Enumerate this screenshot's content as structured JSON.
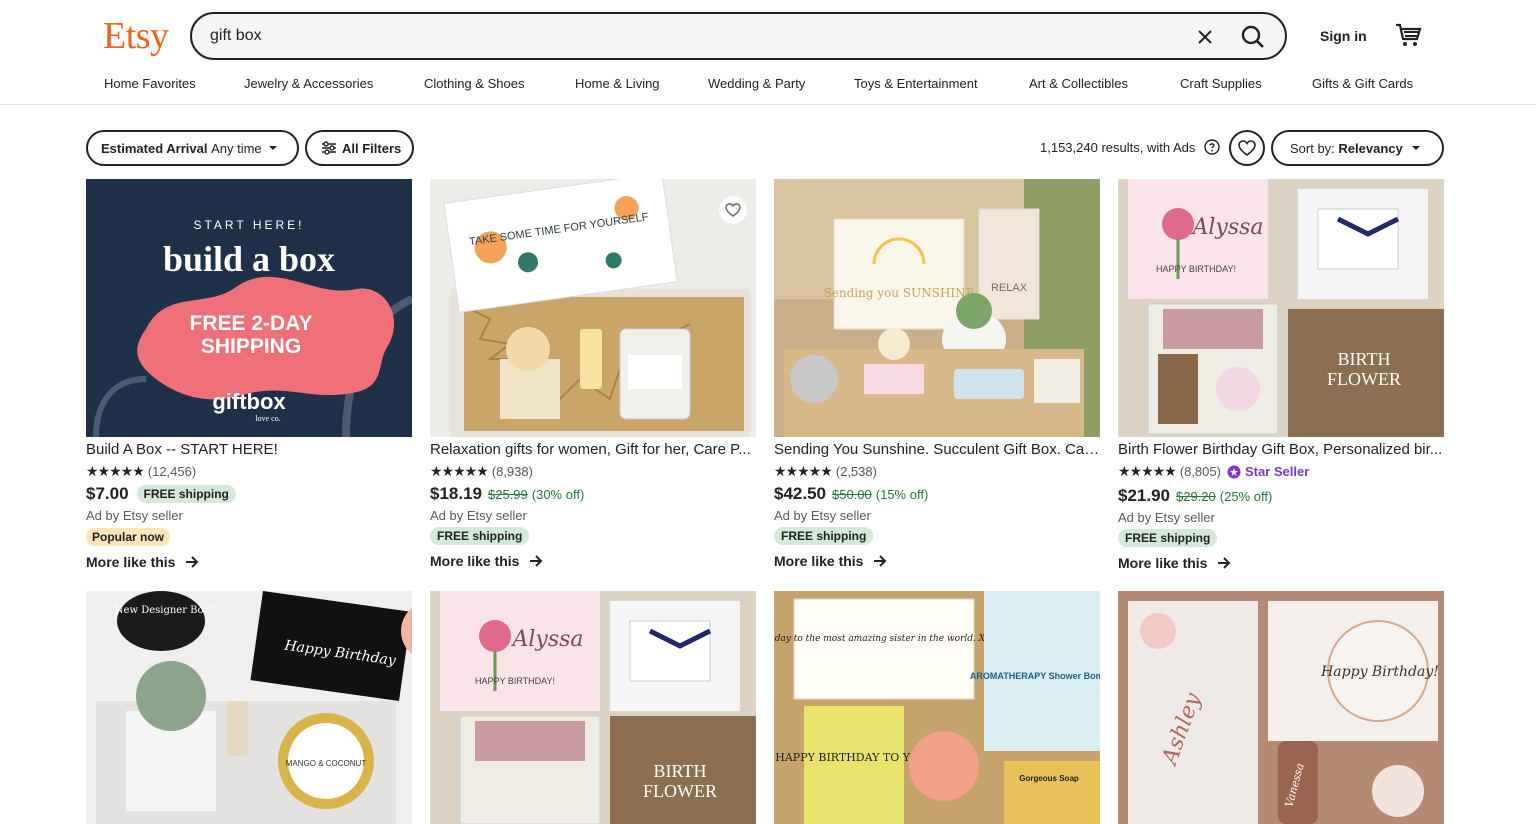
{
  "header": {
    "logo": "Etsy",
    "search_value": "gift box",
    "signin": "Sign in"
  },
  "nav": [
    "Home Favorites",
    "Jewelry & Accessories",
    "Clothing & Shoes",
    "Home & Living",
    "Wedding & Party",
    "Toys & Entertainment",
    "Art & Collectibles",
    "Craft Supplies",
    "Gifts & Gift Cards"
  ],
  "filters": {
    "arrival_label": "Estimated Arrival",
    "arrival_value": "Any time",
    "all_filters": "All Filters",
    "results": "1,153,240 results, with Ads",
    "sort_label": "Sort by:",
    "sort_value": "Relevancy"
  },
  "listings": [
    {
      "title": "Build A Box -- START HERE!",
      "rating_count": "(12,456)",
      "stars": "★★★★★",
      "price": "$7.00",
      "original_price": "",
      "discount": "",
      "free_shipping_inline": "FREE shipping",
      "ad": "Ad by Etsy seller",
      "badge": "Popular now",
      "more": "More like this",
      "image_text": {
        "start": "START HERE!",
        "headline": "build a box",
        "shipping1": "FREE 2-DAY",
        "shipping2": "SHIPPING",
        "brand": "giftbox",
        "brand_sub": "love co."
      }
    },
    {
      "title": "Relaxation gifts for women, Gift for her, Care P...",
      "rating_count": "(8,938)",
      "stars": "★★★★★",
      "price": "$18.19",
      "original_price": "$25.99",
      "discount": "(30% off)",
      "ad": "Ad by Etsy seller",
      "badge": "FREE shipping",
      "more": "More like this",
      "image_text": {
        "card": "TAKE SOME TIME FOR YOURSELF"
      }
    },
    {
      "title": "Sending You Sunshine. Succulent Gift Box. Car...",
      "rating_count": "(2,538)",
      "stars": "★★★★★",
      "price": "$42.50",
      "original_price": "$50.00",
      "discount": "(15% off)",
      "ad": "Ad by Etsy seller",
      "badge": "FREE shipping",
      "more": "More like this",
      "image_text": {
        "card": "Sending you SUNSHINE",
        "relax": "RELAX"
      }
    },
    {
      "title": "Birth Flower Birthday Gift Box, Personalized bir...",
      "rating_count": "(8,805)",
      "stars": "★★★★★",
      "star_seller": "Star Seller",
      "price": "$21.90",
      "original_price": "$29.20",
      "discount": "(25% off)",
      "ad": "Ad by Etsy seller",
      "badge": "FREE shipping",
      "more": "More like this",
      "image_text": {
        "name": "Alyssa",
        "greet": "HAPPY BIRTHDAY!",
        "tag1": "BIRTH",
        "tag2": "FLOWER"
      }
    }
  ],
  "row2_images": [
    {
      "text1": "New Designer Box!",
      "text2": "Happy Birthday",
      "jar": "MANGO & COCONUT"
    },
    {
      "name": "Alyssa",
      "greet": "HAPPY BIRTHDAY!",
      "tag1": "BIRTH",
      "tag2": "FLOWER"
    },
    {
      "note": "Happy Birthday to the most amazing sister in the world. XOXOXO Sarah",
      "candle": "HAPPY BIRTHDAY TO YOU!",
      "bombs": "AROMATHERAPY Shower Bombs",
      "soap": "Gorgeous Soap"
    },
    {
      "name": "Ashley",
      "card": "Happy Birthday!",
      "tumbler": "Vanessa"
    }
  ],
  "colors": {
    "brand": "#f1641e",
    "free_badge": "#d4e9d7",
    "popular_badge": "#fde5b7",
    "discount": "#267a3b",
    "star_seller": "#7f39c8"
  }
}
